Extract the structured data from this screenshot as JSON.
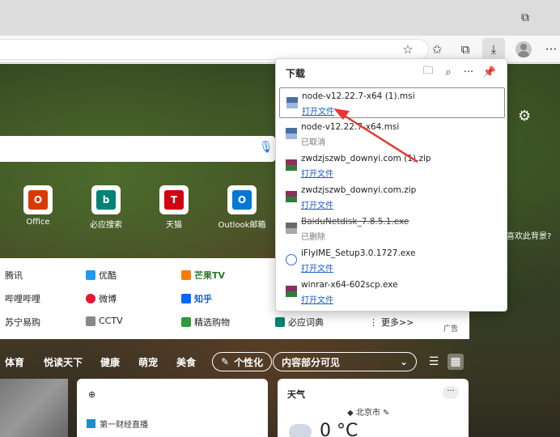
{
  "window": {
    "restore_glyph": "⧉",
    "close_glyph": "✕"
  },
  "toolbar": {
    "buttons": [
      {
        "name": "add-favorite-icon",
        "glyph": "☆"
      },
      {
        "name": "favorites-icon",
        "glyph": "✩"
      },
      {
        "name": "collections-icon",
        "glyph": "⧉"
      },
      {
        "name": "downloads-icon",
        "glyph": "⤓"
      },
      {
        "name": "more-icon",
        "glyph": "···"
      }
    ]
  },
  "ntp": {
    "quick_links": [
      {
        "label": "Office",
        "color": "#d83b01",
        "glyph": "O"
      },
      {
        "label": "必应搜索",
        "color": "#008373",
        "glyph": "b"
      },
      {
        "label": "天猫",
        "color": "#d4000f",
        "glyph": "T"
      },
      {
        "label": "Outlook邮箱",
        "color": "#0078d4",
        "glyph": "O"
      }
    ],
    "side_question": "喜欢此背景?",
    "links": [
      {
        "label": "腾讯",
        "style": "",
        "color": ""
      },
      {
        "label": "优酷",
        "style": "",
        "color": "#1e9bf0"
      },
      {
        "label": "芒果TV",
        "style": "green",
        "color": "#ff7a00"
      },
      {
        "label": "哔哩哔哩",
        "style": "",
        "color": ""
      },
      {
        "label": "微博",
        "style": "",
        "color": "#e6162d"
      },
      {
        "label": "知乎",
        "style": "blue",
        "color": "#0066ff"
      },
      {
        "label": "苏宁易购",
        "style": "",
        "color": ""
      },
      {
        "label": "CCTV",
        "style": "",
        "color": "#888888"
      },
      {
        "label": "精选购物",
        "style": "",
        "color": "#2d9d3a"
      },
      {
        "label": "必应词典",
        "style": "",
        "color": "#008373"
      },
      {
        "label": "更多>>",
        "style": "",
        "color": ""
      }
    ],
    "ad_label": "广告",
    "nav": [
      "体育",
      "悦读天下",
      "健康",
      "萌宠",
      "美食"
    ],
    "personalize": "个性化",
    "content_visibility": "内容部分可见",
    "news_source": "第一财经直播",
    "weather_title": "天气",
    "weather_city": "北京市",
    "weather_temp": "0 °C"
  },
  "downloads": {
    "title": "下载",
    "items": [
      {
        "name": "node-v12.22.7-x64 (1).msi",
        "status": "打开文件",
        "status_type": "link",
        "icon": "msi",
        "selected": true,
        "struck": false
      },
      {
        "name": "node-v12.22.7-x64.msi",
        "status": "已取消",
        "status_type": "muted",
        "icon": "msi",
        "selected": false,
        "struck": false
      },
      {
        "name": "zwdzjszwb_downyi.com (1).zip",
        "status": "打开文件",
        "status_type": "link",
        "icon": "zip",
        "selected": false,
        "struck": false
      },
      {
        "name": "zwdzjszwb_downyi.com.zip",
        "status": "打开文件",
        "status_type": "link",
        "icon": "zip",
        "selected": false,
        "struck": false
      },
      {
        "name": "BaiduNetdisk_7.8.5.1.exe",
        "status": "已删除",
        "status_type": "muted",
        "icon": "exe",
        "selected": false,
        "struck": true
      },
      {
        "name": "iFlyIME_Setup3.0.1727.exe",
        "status": "打开文件",
        "status_type": "link",
        "icon": "ifly",
        "selected": false,
        "struck": false
      },
      {
        "name": "winrar-x64-602scp.exe",
        "status": "打开文件",
        "status_type": "link",
        "icon": "zip",
        "selected": false,
        "struck": false
      }
    ]
  },
  "colors": {
    "accent": "#1d5fc8",
    "annotation": "#e53935"
  }
}
